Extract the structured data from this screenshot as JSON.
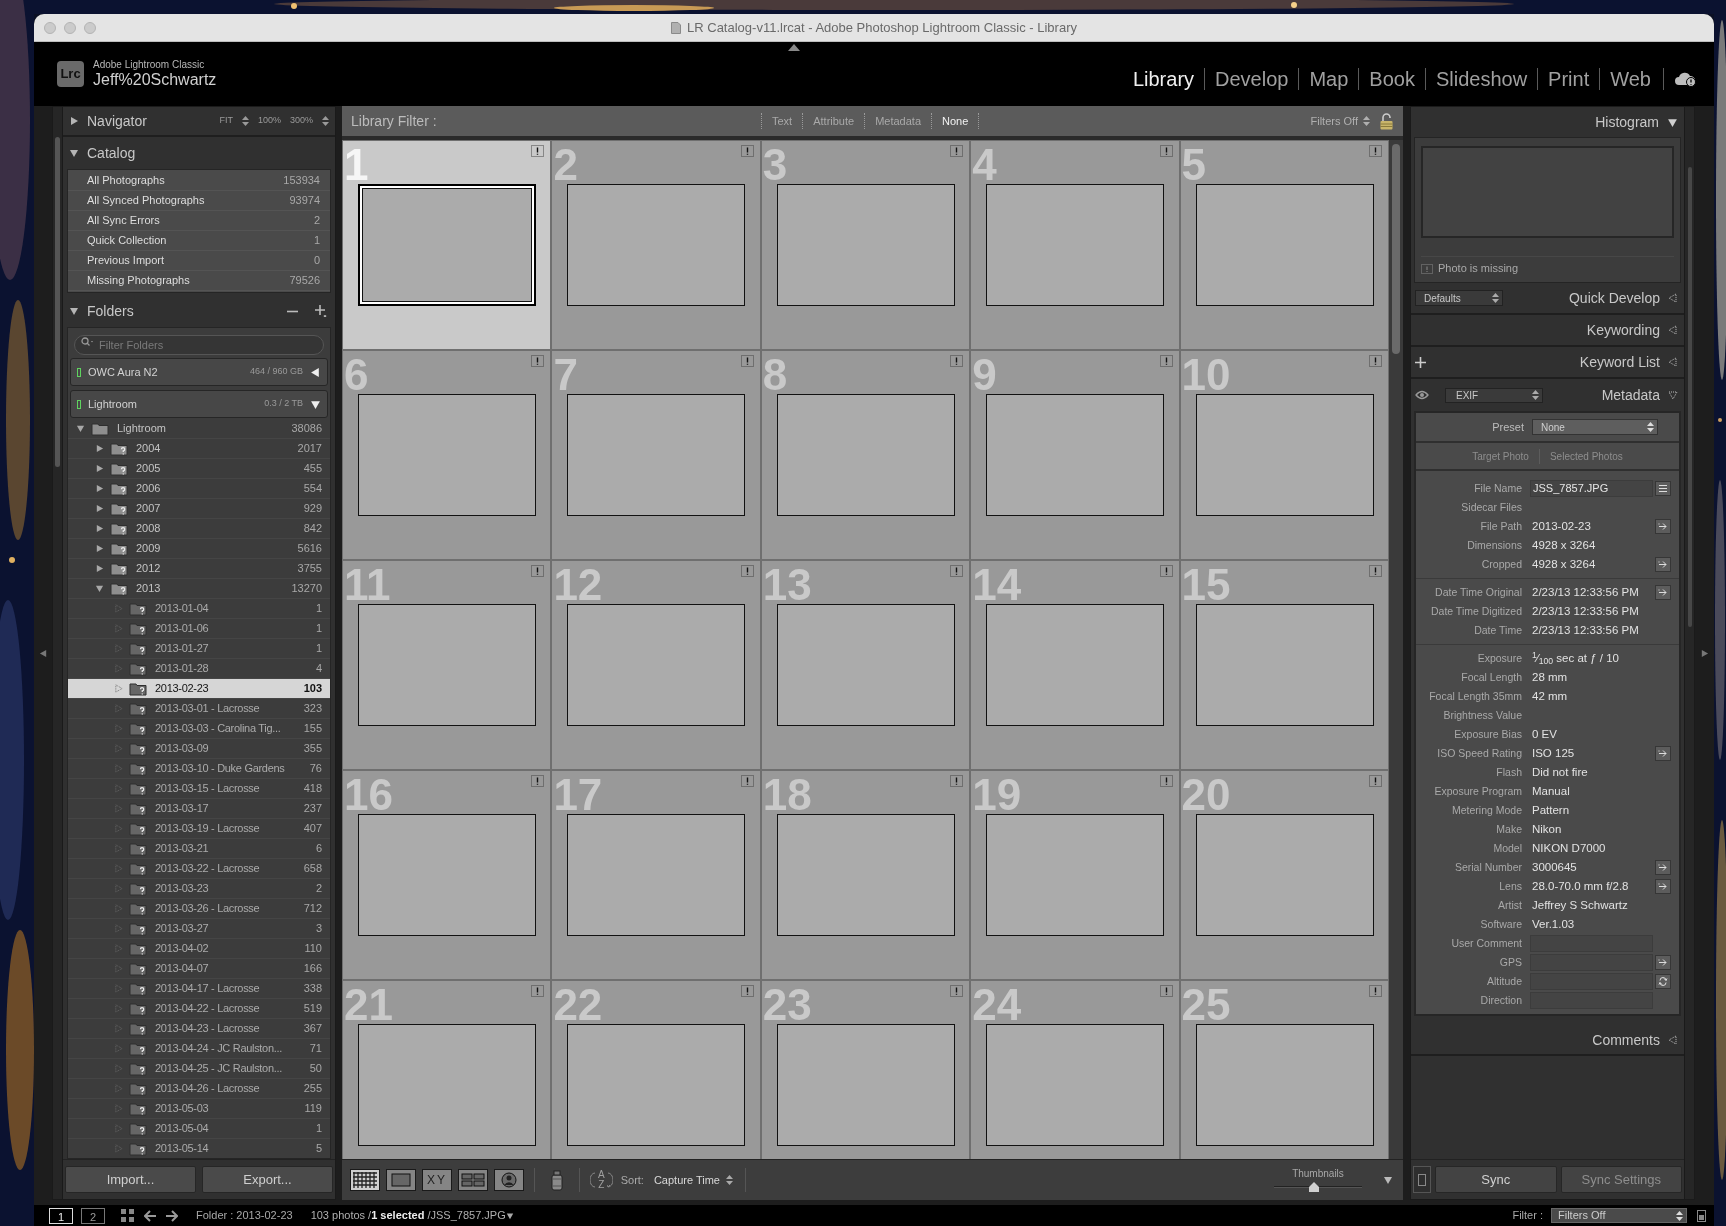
{
  "window": {
    "title": "LR Catalog-v11.lrcat - Adobe Photoshop Lightroom Classic - Library"
  },
  "brand": {
    "logo": "Lrc",
    "product": "Adobe Lightroom Classic",
    "user": "Jeff%20Schwartz"
  },
  "modules": [
    {
      "label": "Library",
      "selected": true
    },
    {
      "label": "Develop",
      "selected": false
    },
    {
      "label": "Map",
      "selected": false
    },
    {
      "label": "Book",
      "selected": false
    },
    {
      "label": "Slideshow",
      "selected": false
    },
    {
      "label": "Print",
      "selected": false
    },
    {
      "label": "Web",
      "selected": false
    }
  ],
  "left_panel": {
    "navigator": {
      "title": "Navigator",
      "expanded": false,
      "zoom_options": [
        {
          "label": "FIT",
          "kind": "menu"
        },
        {
          "label": "100%",
          "kind": "fixed"
        },
        {
          "label": "300%",
          "kind": "menu"
        }
      ]
    },
    "catalog": {
      "title": "Catalog",
      "expanded": true,
      "items": [
        {
          "label": "All Photographs",
          "count": "153934"
        },
        {
          "label": "All Synced Photographs",
          "count": "93974"
        },
        {
          "label": "All Sync Errors",
          "count": "2"
        },
        {
          "label": "Quick Collection",
          "count": "1"
        },
        {
          "label": "Previous Import",
          "count": "0"
        },
        {
          "label": "Missing Photographs",
          "count": "79526"
        }
      ]
    },
    "folders": {
      "title": "Folders",
      "expanded": true,
      "filter_placeholder": "Filter Folders",
      "volumes": [
        {
          "name": "OWC Aura N2",
          "usage": "464 / 960 GB",
          "expanded": false
        },
        {
          "name": "Lightroom",
          "usage": "0.3 / 2 TB",
          "expanded": true
        }
      ],
      "tree": [
        {
          "label": "Lightroom",
          "count": "38086",
          "missing": false,
          "selected": false,
          "expanded": true,
          "children": [
            {
              "label": "2004",
              "count": "2017",
              "missing": true,
              "selected": false,
              "expanded": false
            },
            {
              "label": "2005",
              "count": "455",
              "missing": true,
              "selected": false,
              "expanded": false
            },
            {
              "label": "2006",
              "count": "554",
              "missing": true,
              "selected": false,
              "expanded": false
            },
            {
              "label": "2007",
              "count": "929",
              "missing": true,
              "selected": false,
              "expanded": false
            },
            {
              "label": "2008",
              "count": "842",
              "missing": true,
              "selected": false,
              "expanded": false
            },
            {
              "label": "2009",
              "count": "5616",
              "missing": true,
              "selected": false,
              "expanded": false
            },
            {
              "label": "2012",
              "count": "3755",
              "missing": true,
              "selected": false,
              "expanded": false
            },
            {
              "label": "2013",
              "count": "13270",
              "missing": true,
              "selected": false,
              "expanded": true,
              "children": [
                {
                  "label": "2013-01-04",
                  "count": "1",
                  "missing": true,
                  "selected": false
                },
                {
                  "label": "2013-01-06",
                  "count": "1",
                  "missing": true,
                  "selected": false
                },
                {
                  "label": "2013-01-27",
                  "count": "1",
                  "missing": true,
                  "selected": false
                },
                {
                  "label": "2013-01-28",
                  "count": "4",
                  "missing": true,
                  "selected": false
                },
                {
                  "label": "2013-02-23",
                  "count": "103",
                  "missing": true,
                  "selected": true
                },
                {
                  "label": "2013-03-01 - Lacrosse",
                  "count": "323",
                  "missing": true,
                  "selected": false
                },
                {
                  "label": "2013-03-03 - Carolina Tig...",
                  "count": "155",
                  "missing": true,
                  "selected": false
                },
                {
                  "label": "2013-03-09",
                  "count": "355",
                  "missing": true,
                  "selected": false
                },
                {
                  "label": "2013-03-10 - Duke Gardens",
                  "count": "76",
                  "missing": true,
                  "selected": false
                },
                {
                  "label": "2013-03-15 - Lacrosse",
                  "count": "418",
                  "missing": true,
                  "selected": false
                },
                {
                  "label": "2013-03-17",
                  "count": "237",
                  "missing": true,
                  "selected": false
                },
                {
                  "label": "2013-03-19 - Lacrosse",
                  "count": "407",
                  "missing": true,
                  "selected": false
                },
                {
                  "label": "2013-03-21",
                  "count": "6",
                  "missing": true,
                  "selected": false
                },
                {
                  "label": "2013-03-22 - Lacrosse",
                  "count": "658",
                  "missing": true,
                  "selected": false
                },
                {
                  "label": "2013-03-23",
                  "count": "2",
                  "missing": true,
                  "selected": false
                },
                {
                  "label": "2013-03-26 - Lacrosse",
                  "count": "712",
                  "missing": true,
                  "selected": false
                },
                {
                  "label": "2013-03-27",
                  "count": "3",
                  "missing": true,
                  "selected": false
                },
                {
                  "label": "2013-04-02",
                  "count": "110",
                  "missing": true,
                  "selected": false
                },
                {
                  "label": "2013-04-07",
                  "count": "166",
                  "missing": true,
                  "selected": false
                },
                {
                  "label": "2013-04-17 - Lacrosse",
                  "count": "338",
                  "missing": true,
                  "selected": false
                },
                {
                  "label": "2013-04-22 - Lacrosse",
                  "count": "519",
                  "missing": true,
                  "selected": false
                },
                {
                  "label": "2013-04-23 - Lacrosse",
                  "count": "367",
                  "missing": true,
                  "selected": false
                },
                {
                  "label": "2013-04-24 - JC Raulston...",
                  "count": "71",
                  "missing": true,
                  "selected": false
                },
                {
                  "label": "2013-04-25 - JC Raulston...",
                  "count": "50",
                  "missing": true,
                  "selected": false
                },
                {
                  "label": "2013-04-26 - Lacrosse",
                  "count": "255",
                  "missing": true,
                  "selected": false
                },
                {
                  "label": "2013-05-03",
                  "count": "119",
                  "missing": true,
                  "selected": false
                },
                {
                  "label": "2013-05-04",
                  "count": "1",
                  "missing": true,
                  "selected": false
                },
                {
                  "label": "2013-05-14",
                  "count": "5",
                  "missing": true,
                  "selected": false
                }
              ]
            }
          ]
        }
      ]
    },
    "buttons": [
      "Import...",
      "Export..."
    ]
  },
  "library_filter": {
    "label": "Library Filter :",
    "options": [
      {
        "label": "Text",
        "selected": false
      },
      {
        "label": "Attribute",
        "selected": false
      },
      {
        "label": "Metadata",
        "selected": false
      },
      {
        "label": "None",
        "selected": true
      }
    ],
    "preset": "Filters Off"
  },
  "grid": {
    "cells": [
      {
        "number": "1",
        "selected": true
      },
      {
        "number": "2",
        "selected": false
      },
      {
        "number": "3",
        "selected": false
      },
      {
        "number": "4",
        "selected": false
      },
      {
        "number": "5",
        "selected": false
      },
      {
        "number": "6",
        "selected": false
      },
      {
        "number": "7",
        "selected": false
      },
      {
        "number": "8",
        "selected": false
      },
      {
        "number": "9",
        "selected": false
      },
      {
        "number": "10",
        "selected": false
      },
      {
        "number": "11",
        "selected": false
      },
      {
        "number": "12",
        "selected": false
      },
      {
        "number": "13",
        "selected": false
      },
      {
        "number": "14",
        "selected": false
      },
      {
        "number": "15",
        "selected": false
      },
      {
        "number": "16",
        "selected": false
      },
      {
        "number": "17",
        "selected": false
      },
      {
        "number": "18",
        "selected": false
      },
      {
        "number": "19",
        "selected": false
      },
      {
        "number": "20",
        "selected": false
      },
      {
        "number": "21",
        "selected": false
      },
      {
        "number": "22",
        "selected": false
      },
      {
        "number": "23",
        "selected": false
      },
      {
        "number": "24",
        "selected": false
      },
      {
        "number": "25",
        "selected": false
      }
    ]
  },
  "toolbar": {
    "view_modes": [
      {
        "kind": "grid",
        "selected": true
      },
      {
        "kind": "loupe",
        "selected": false
      },
      {
        "kind": "compare",
        "label": "XY",
        "selected": false
      },
      {
        "kind": "survey",
        "selected": false
      },
      {
        "kind": "people",
        "selected": false
      }
    ],
    "sort_toggle": [
      "A",
      "Z"
    ],
    "sort_label": "Sort:",
    "sort_value": "Capture Time",
    "thumbnails_label": "Thumbnails",
    "thumbnail_size": {
      "level": 0.46
    }
  },
  "right_panel": {
    "histogram": {
      "title": "Histogram",
      "expanded": true,
      "message": "Photo is missing"
    },
    "sections": [
      {
        "kind": "quick_develop",
        "title": "Quick Develop",
        "preset": "Defaults",
        "expanded": false
      },
      {
        "kind": "plain",
        "title": "Keywording",
        "expanded": false
      },
      {
        "kind": "keyword_list",
        "title": "Keyword List",
        "expanded": false
      }
    ],
    "metadata": {
      "title": "Metadata",
      "view": "EXIF",
      "expanded": true,
      "preset_label": "Preset",
      "preset_value": "None",
      "tabs": [
        {
          "label": "Target Photo",
          "disabled": true
        },
        {
          "label": "Selected Photos",
          "disabled": true
        }
      ],
      "groups": [
        {
          "fields": [
            {
              "label": "File Name",
              "value": "JSS_7857.JPG",
              "kind": "listbox"
            },
            {
              "label": "Sidecar Files",
              "kind": "text"
            },
            {
              "label": "File Path",
              "value": "2013-02-23",
              "kind": "linked"
            },
            {
              "label": "Dimensions",
              "value": "4928 x 3264",
              "kind": "text"
            },
            {
              "label": "Cropped",
              "value": "4928 x 3264",
              "kind": "linked"
            }
          ]
        },
        {
          "fields": [
            {
              "label": "Date Time Original",
              "value": "2/23/13 12:33:56 PM",
              "kind": "linked"
            },
            {
              "label": "Date Time Digitized",
              "value": "2/23/13 12:33:56 PM",
              "kind": "text"
            },
            {
              "label": "Date Time",
              "value": "2/23/13 12:33:56 PM",
              "kind": "text"
            }
          ]
        },
        {
          "fields": [
            {
              "label": "Exposure",
              "value": "$^{1}$⁄$_{100}$ sec at ƒ / 10",
              "kind": "text"
            },
            {
              "label": "Focal Length",
              "value": "28 mm",
              "kind": "text"
            },
            {
              "label": "Focal Length 35mm",
              "value": "42 mm",
              "kind": "text"
            },
            {
              "label": "Brightness Value",
              "kind": "text"
            },
            {
              "label": "Exposure Bias",
              "value": "0 EV",
              "kind": "text"
            },
            {
              "label": "ISO Speed Rating",
              "value": "ISO 125",
              "kind": "linked"
            },
            {
              "label": "Flash",
              "value": "Did not fire",
              "kind": "text"
            },
            {
              "label": "Exposure Program",
              "value": "Manual",
              "kind": "text"
            },
            {
              "label": "Metering Mode",
              "value": "Pattern",
              "kind": "text"
            },
            {
              "label": "Make",
              "value": "Nikon",
              "kind": "text"
            },
            {
              "label": "Model",
              "value": "NIKON D7000",
              "kind": "text"
            },
            {
              "label": "Serial Number",
              "value": "3000645",
              "kind": "linked"
            },
            {
              "label": "Lens",
              "value": "28.0-70.0 mm f/2.8",
              "kind": "linked"
            },
            {
              "label": "Artist",
              "value": "Jeffrey S Schwartz",
              "kind": "text"
            },
            {
              "label": "Software",
              "value": "Ver.1.03",
              "kind": "text"
            },
            {
              "label": "User Comment",
              "kind": "box"
            },
            {
              "label": "GPS",
              "kind": "linkbox"
            },
            {
              "label": "Altitude",
              "kind": "syncbox"
            },
            {
              "label": "Direction",
              "kind": "box"
            }
          ]
        }
      ]
    },
    "comments": {
      "title": "Comments",
      "expanded": false
    },
    "sync_buttons": [
      {
        "label": "Sync",
        "disabled": false
      },
      {
        "label": "Sync Settings",
        "disabled": true
      }
    ]
  },
  "filmstrip": {
    "monitors": [
      {
        "label": "1",
        "selected": true
      },
      {
        "label": "2",
        "selected": false
      }
    ],
    "source": "Folder : 2013-02-23",
    "status": "103 photos /**1 selected** /JSS_7857.JPG",
    "filter_label": "Filter :",
    "filter_value": "Filters Off"
  }
}
